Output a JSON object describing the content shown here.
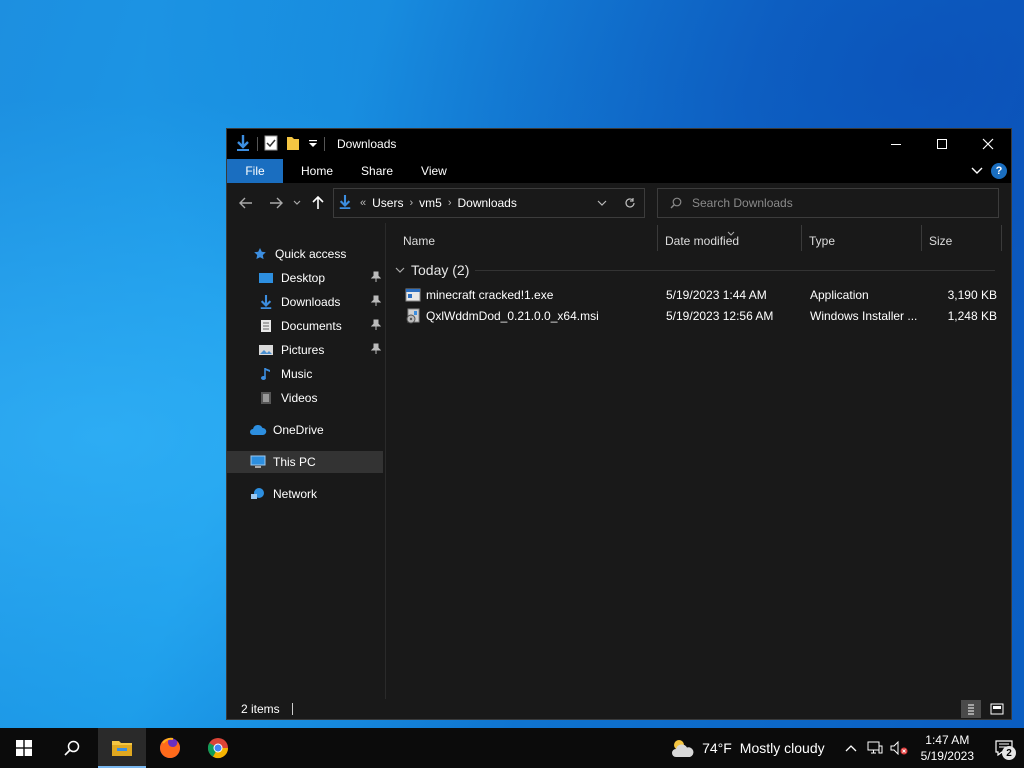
{
  "window": {
    "title": "Downloads",
    "ribbon_tabs": [
      "File",
      "Home",
      "Share",
      "View"
    ],
    "help_label": "?"
  },
  "address": {
    "overflow": "«",
    "crumbs": [
      "Users",
      "vm5",
      "Downloads"
    ]
  },
  "search": {
    "placeholder": "Search Downloads"
  },
  "nav_pane": {
    "quick_access": "Quick access",
    "items": [
      "Desktop",
      "Downloads",
      "Documents",
      "Pictures",
      "Music",
      "Videos"
    ],
    "onedrive": "OneDrive",
    "this_pc": "This PC",
    "network": "Network"
  },
  "columns": {
    "name": "Name",
    "date": "Date modified",
    "type": "Type",
    "size": "Size"
  },
  "group": {
    "label": "Today (2)"
  },
  "files": [
    {
      "name": "minecraft cracked!1.exe",
      "date": "5/19/2023 1:44 AM",
      "type": "Application",
      "size": "3,190 KB"
    },
    {
      "name": "QxlWddmDod_0.21.0.0_x64.msi",
      "date": "5/19/2023 12:56 AM",
      "type": "Windows Installer ...",
      "size": "1,248 KB"
    }
  ],
  "status": {
    "items": "2 items"
  },
  "taskbar": {
    "weather_temp": "74°F",
    "weather_cond": "Mostly cloudy",
    "time": "1:47 AM",
    "date": "5/19/2023",
    "notif_count": "2"
  },
  "colors": {
    "accent": "#1a6ec0",
    "window_bg": "#191919",
    "titlebar": "#000000",
    "folder": "#f4c542"
  }
}
